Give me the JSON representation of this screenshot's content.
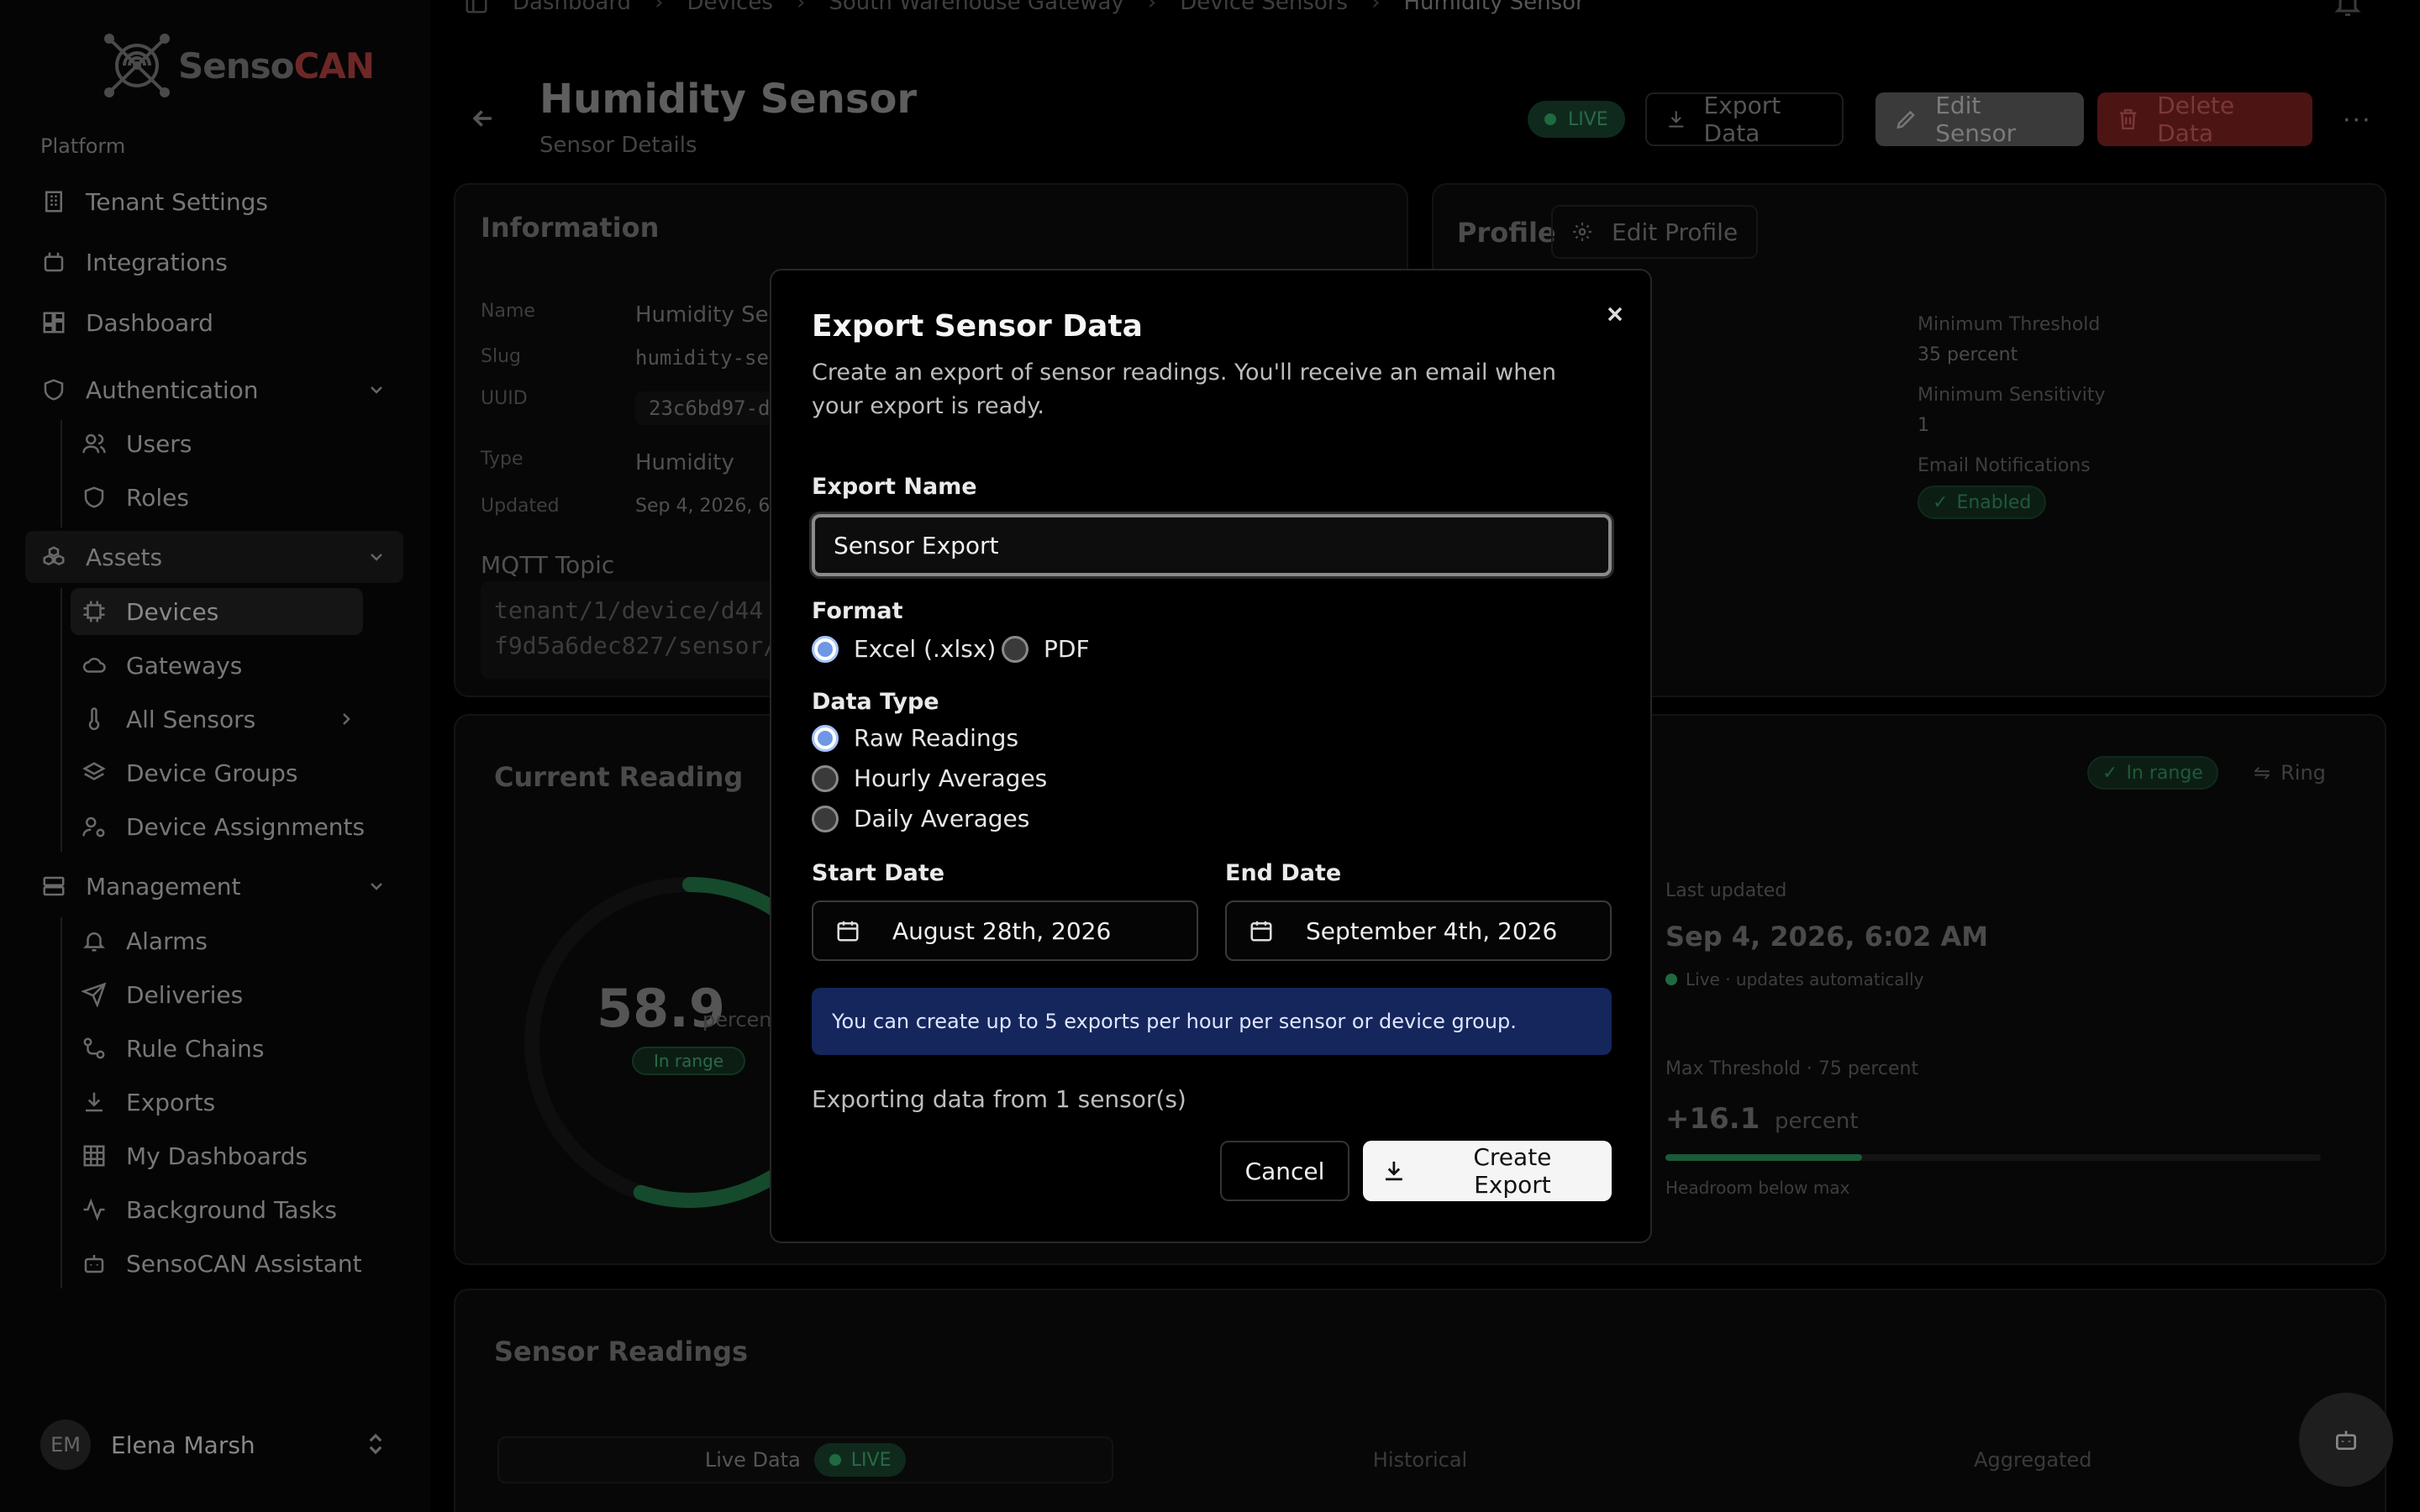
{
  "app": {
    "logo_prefix": "Senso",
    "logo_suffix": "CAN"
  },
  "sidebar": {
    "platform_label": "Platform",
    "platform_items": [
      "Tenant Settings",
      "Integrations",
      "Dashboard"
    ],
    "authentication": {
      "label": "Authentication",
      "items": [
        "Users",
        "Roles"
      ]
    },
    "assets": {
      "label": "Assets",
      "items": [
        "Devices",
        "Gateways",
        "All Sensors",
        "Device Groups",
        "Device Assignments"
      ]
    },
    "management": {
      "label": "Management",
      "items": [
        "Alarms",
        "Deliveries",
        "Rule Chains",
        "Exports",
        "My Dashboards",
        "Background Tasks",
        "SensoCAN Assistant"
      ]
    },
    "user": {
      "initials": "EM",
      "name": "Elena Marsh"
    }
  },
  "breadcrumbs": [
    "Dashboard",
    "Devices",
    "South Warehouse Gateway",
    "Device Sensors",
    "Humidity Sensor"
  ],
  "header": {
    "title": "Humidity Sensor",
    "subtitle": "Sensor Details",
    "live_label": "LIVE",
    "export_label": "Export Data",
    "edit_label": "Edit Sensor",
    "delete_label": "Delete Data",
    "more_label": "···"
  },
  "information": {
    "title": "Information",
    "name_label": "Name",
    "name_value": "Humidity Sen",
    "slug_label": "Slug",
    "slug_value": "humidity-se",
    "uuid_label": "UUID",
    "uuid_value": "23c6bd97-d",
    "type_label": "Type",
    "type_value": "Humidity",
    "updated_label": "Updated",
    "updated_value": "Sep 4, 2026, 6:",
    "mqtt_label": "MQTT Topic",
    "mqtt_line1": "tenant/1/device/d44",
    "mqtt_line2": "f9d5a6dec827/sensor/"
  },
  "profile": {
    "title": "Profile",
    "edit_label": "Edit Profile",
    "min_threshold_label": "Minimum Threshold",
    "min_threshold_value": "35 percent",
    "min_sensitivity_label": "Minimum Sensitivity",
    "min_sensitivity_value": "1",
    "email_label": "Email Notifications",
    "email_value": "Enabled"
  },
  "current_reading": {
    "title": "Current Reading",
    "value": "58.9",
    "unit": "percen",
    "badge": "In range",
    "status_badge": "In range",
    "ring_label": "Ring",
    "last_updated_label": "Last updated",
    "last_updated_value": "Sep 4, 2026, 6:02 AM",
    "live_note": "Live · updates automatically",
    "max_label": "Max Threshold · 75 percent",
    "headroom_value": "+16.1",
    "headroom_unit": "percent",
    "headroom_note": "Headroom below max",
    "headroom_fraction": 0.3,
    "gauge_fraction": 0.55
  },
  "readings": {
    "title": "Sensor Readings",
    "tabs": [
      "Live Data",
      "Historical",
      "Aggregated"
    ],
    "live_badge": "LIVE"
  },
  "modal": {
    "title": "Export Sensor Data",
    "description": "Create an export of sensor readings. You'll receive an email when your export is ready.",
    "name_label": "Export Name",
    "name_value": "Sensor Export",
    "format_label": "Format",
    "format_options": [
      "Excel (.xlsx)",
      "PDF"
    ],
    "format_selected": "Excel (.xlsx)",
    "type_label": "Data Type",
    "type_options": [
      "Raw Readings",
      "Hourly Averages",
      "Daily Averages"
    ],
    "type_selected": "Raw Readings",
    "start_label": "Start Date",
    "start_value": "August 28th, 2026",
    "end_label": "End Date",
    "end_value": "September 4th, 2026",
    "info": "You can create up to 5 exports per hour per sensor or device group.",
    "note": "Exporting data from 1 sensor(s)",
    "cancel_label": "Cancel",
    "create_label": "Create Export"
  },
  "colors": {
    "accent_blue": "#6e97e6",
    "info_bg": "#15265c",
    "live_green": "#1f6a40",
    "danger": "#4d1414"
  }
}
